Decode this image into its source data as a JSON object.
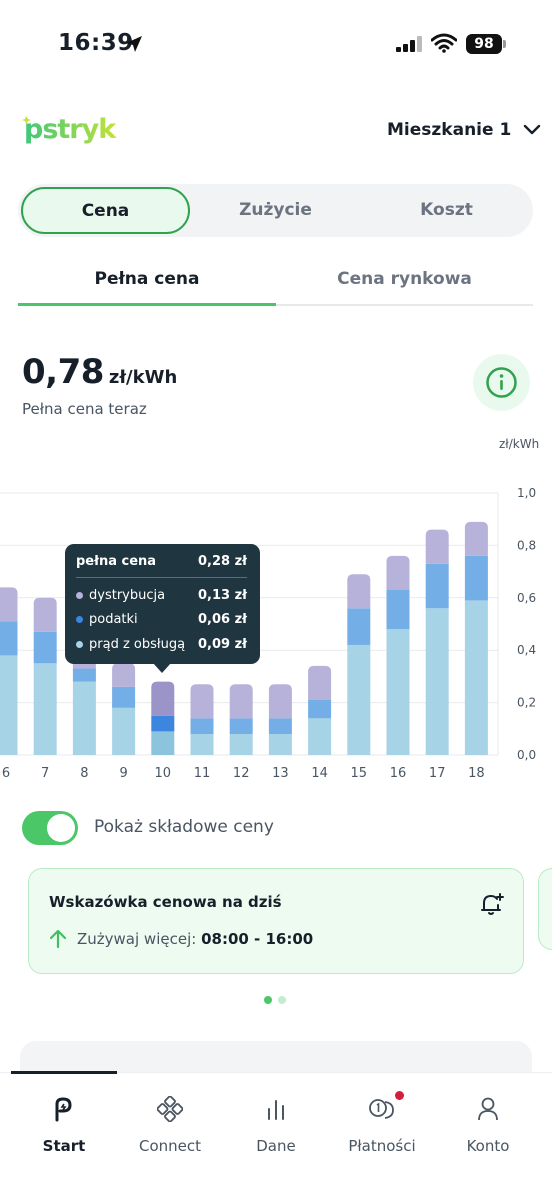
{
  "status_bar": {
    "time": "16:39",
    "battery": "98"
  },
  "header": {
    "logo_text": "pstryk",
    "apartment": "Mieszkanie 1"
  },
  "segments": [
    {
      "label": "Cena",
      "active": true
    },
    {
      "label": "Zużycie",
      "active": false
    },
    {
      "label": "Koszt",
      "active": false
    }
  ],
  "subtabs": [
    {
      "label": "Pełna cena",
      "active": true
    },
    {
      "label": "Cena rynkowa",
      "active": false
    }
  ],
  "price": {
    "value": "0,78",
    "unit": "zł/kWh",
    "subtitle": "Pełna cena teraz"
  },
  "chart_unit": "zł/kWh",
  "chart_data": {
    "type": "bar",
    "stacked": true,
    "categories": [
      "6",
      "7",
      "8",
      "9",
      "10",
      "11",
      "12",
      "13",
      "14",
      "15",
      "16",
      "17",
      "18"
    ],
    "series": [
      {
        "name": "prąd z obsługą",
        "color": "#a7d3e6",
        "values": [
          0.38,
          0.35,
          0.28,
          0.18,
          0.09,
          0.08,
          0.08,
          0.08,
          0.14,
          0.42,
          0.48,
          0.56,
          0.59
        ]
      },
      {
        "name": "podatki",
        "color": "#74aee6",
        "values": [
          0.13,
          0.12,
          0.05,
          0.08,
          0.06,
          0.06,
          0.06,
          0.06,
          0.07,
          0.14,
          0.15,
          0.17,
          0.17
        ]
      },
      {
        "name": "dystrybucja",
        "color": "#b7b2da",
        "values": [
          0.13,
          0.13,
          0.11,
          0.09,
          0.13,
          0.13,
          0.13,
          0.13,
          0.13,
          0.13,
          0.13,
          0.13,
          0.13
        ]
      }
    ],
    "highlight_index": 4,
    "highlight_colors": [
      "#8cc4de",
      "#3d86e0",
      "#9a94c9"
    ],
    "y_ticks": [
      "0,0",
      "0,2",
      "0,4",
      "0,6",
      "0,8",
      "1,0"
    ],
    "ylim": [
      0,
      1.0
    ],
    "grid": true
  },
  "tooltip": {
    "title": "pełna cena",
    "total": "0,28 zł",
    "rows": [
      {
        "label": "dystrybucja",
        "value": "0,13 zł",
        "color": "#b7b2da"
      },
      {
        "label": "podatki",
        "value": "0,06 zł",
        "color": "#3d86e0"
      },
      {
        "label": "prąd z obsługą",
        "value": "0,09 zł",
        "color": "#a7d3e6"
      }
    ]
  },
  "toggle": {
    "label": "Pokaż składowe ceny",
    "on": true
  },
  "tip": {
    "title": "Wskazówka cenowa na dziś",
    "action": "Zużywaj więcej:",
    "hours": "08:00 - 16:00"
  },
  "nav": [
    {
      "label": "Start",
      "icon": "pstryk-logo-icon",
      "active": true
    },
    {
      "label": "Connect",
      "icon": "connect-grid-icon",
      "active": false
    },
    {
      "label": "Dane",
      "icon": "bar-chart-icon",
      "active": false
    },
    {
      "label": "Płatności",
      "icon": "coins-icon",
      "active": false,
      "badge": true
    },
    {
      "label": "Konto",
      "icon": "user-icon",
      "active": false
    }
  ]
}
